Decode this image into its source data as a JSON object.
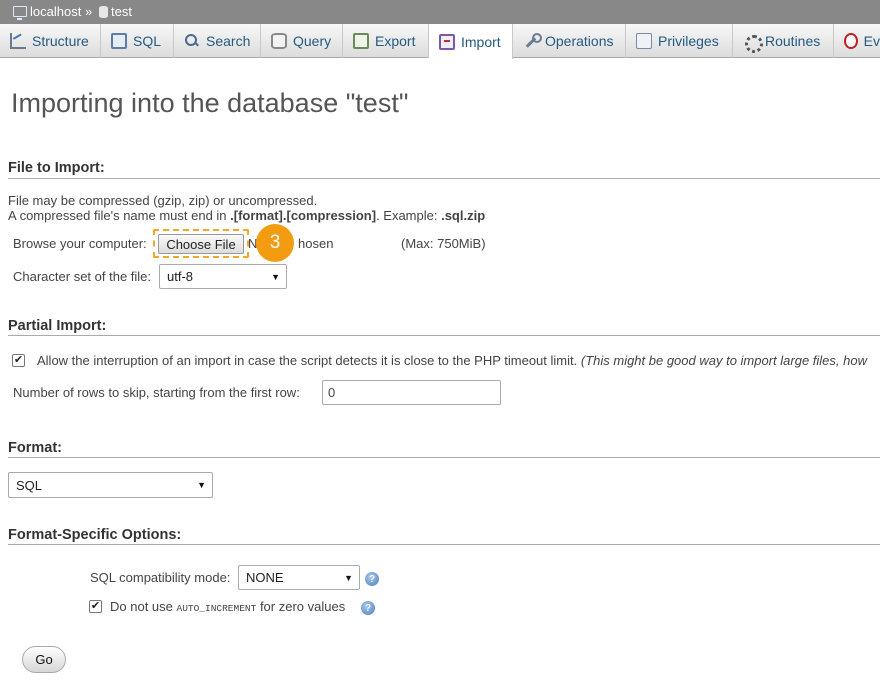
{
  "breadcrumb": {
    "server": "localhost",
    "separator": "»",
    "database": "test"
  },
  "tabs": [
    {
      "label": "Structure",
      "icon": "structure-icon"
    },
    {
      "label": "SQL",
      "icon": "sql-icon"
    },
    {
      "label": "Search",
      "icon": "search-icon"
    },
    {
      "label": "Query",
      "icon": "query-icon"
    },
    {
      "label": "Export",
      "icon": "export-icon"
    },
    {
      "label": "Import",
      "icon": "import-icon",
      "active": true
    },
    {
      "label": "Operations",
      "icon": "operations-icon"
    },
    {
      "label": "Privileges",
      "icon": "privileges-icon"
    },
    {
      "label": "Routines",
      "icon": "routines-icon"
    },
    {
      "label": "Ev",
      "icon": "events-icon"
    }
  ],
  "page_title": "Importing into the database \"test\"",
  "file_section": {
    "title": "File to Import:",
    "line1": "File may be compressed (gzip, zip) or uncompressed.",
    "line2_prefix": "A compressed file's name must end in ",
    "line2_format": ".[format].[compression]",
    "line2_mid": ". Example: ",
    "line2_example": ".sql.zip",
    "browse_label": "Browse your computer:",
    "choose_button": "Choose File",
    "no_file_prefix": "N",
    "no_file_suffix": "hosen",
    "max_size": "(Max: 750MiB)",
    "step_badge": "3",
    "charset_label": "Character set of the file:",
    "charset_value": "utf-8"
  },
  "partial_section": {
    "title": "Partial Import:",
    "allow_interrupt_label": "Allow the interruption of an import in case the script detects it is close to the PHP timeout limit.",
    "allow_interrupt_note": "(This might be good way to import large files, how",
    "allow_interrupt_checked": true,
    "skip_rows_label": "Number of rows to skip, starting from the first row:",
    "skip_rows_value": "0"
  },
  "format_section": {
    "title": "Format:",
    "format_value": "SQL"
  },
  "options_section": {
    "title": "Format-Specific Options:",
    "compat_label": "SQL compatibility mode:",
    "compat_value": "NONE",
    "no_auto_prefix": "Do not use ",
    "no_auto_code": "AUTO_INCREMENT",
    "no_auto_suffix": " for zero values",
    "no_auto_checked": true
  },
  "go_button": "Go",
  "colors": {
    "accent_orange": "#f39c12",
    "link_blue": "#235a81",
    "breadcrumb_bg": "#888888"
  }
}
